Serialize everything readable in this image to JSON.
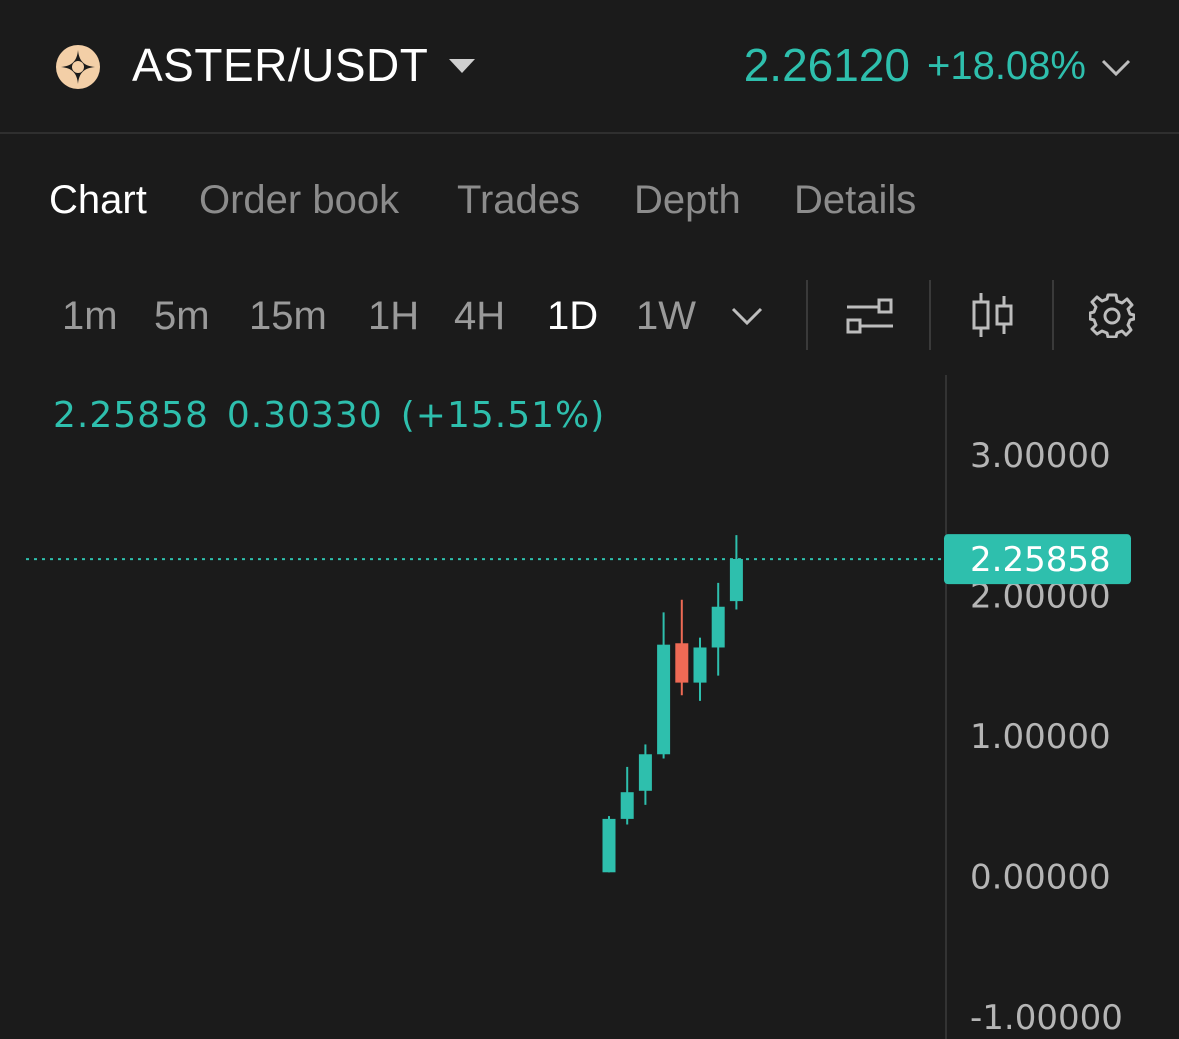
{
  "header": {
    "pair": "ASTER/USDT",
    "price": "2.26120",
    "change": "+18.08%",
    "colors": {
      "up": "#2ebfad",
      "down": "#ee6a55",
      "logo": "#f3cfa7"
    }
  },
  "tabs": [
    {
      "label": "Chart",
      "active": true
    },
    {
      "label": "Order book",
      "active": false
    },
    {
      "label": "Trades",
      "active": false
    },
    {
      "label": "Depth",
      "active": false
    },
    {
      "label": "Details",
      "active": false
    }
  ],
  "timeframes": [
    {
      "label": "1m",
      "active": false
    },
    {
      "label": "5m",
      "active": false
    },
    {
      "label": "15m",
      "active": false
    },
    {
      "label": "1H",
      "active": false
    },
    {
      "label": "4H",
      "active": false
    },
    {
      "label": "1D",
      "active": true
    },
    {
      "label": "1W",
      "active": false
    }
  ],
  "toolbar_icons": [
    "chevron-down-icon",
    "indicators-icon",
    "candlestick-type-icon",
    "settings-gear-icon"
  ],
  "legend": {
    "close": "2.25858",
    "change": "0.30330",
    "change_pct": "(+15.51%)"
  },
  "chart_data": {
    "type": "candlestick",
    "y_axis_labels": [
      "3.00000",
      "2.00000",
      "1.00000",
      "0.00000",
      "-1.00000"
    ],
    "ylim": [
      -1.0,
      3.0
    ],
    "last_price": "2.25858",
    "last_price_value": 2.25858,
    "candles": [
      {
        "open": 0.03,
        "high": 0.43,
        "low": 0.03,
        "close": 0.41
      },
      {
        "open": 0.41,
        "high": 0.78,
        "low": 0.37,
        "close": 0.6
      },
      {
        "open": 0.61,
        "high": 0.94,
        "low": 0.51,
        "close": 0.87
      },
      {
        "open": 0.87,
        "high": 1.88,
        "low": 0.84,
        "close": 1.65
      },
      {
        "open": 1.66,
        "high": 1.97,
        "low": 1.29,
        "close": 1.38
      },
      {
        "open": 1.38,
        "high": 1.7,
        "low": 1.25,
        "close": 1.63
      },
      {
        "open": 1.63,
        "high": 2.09,
        "low": 1.43,
        "close": 1.92
      },
      {
        "open": 1.96,
        "high": 2.43,
        "low": 1.9,
        "close": 2.26
      }
    ]
  }
}
